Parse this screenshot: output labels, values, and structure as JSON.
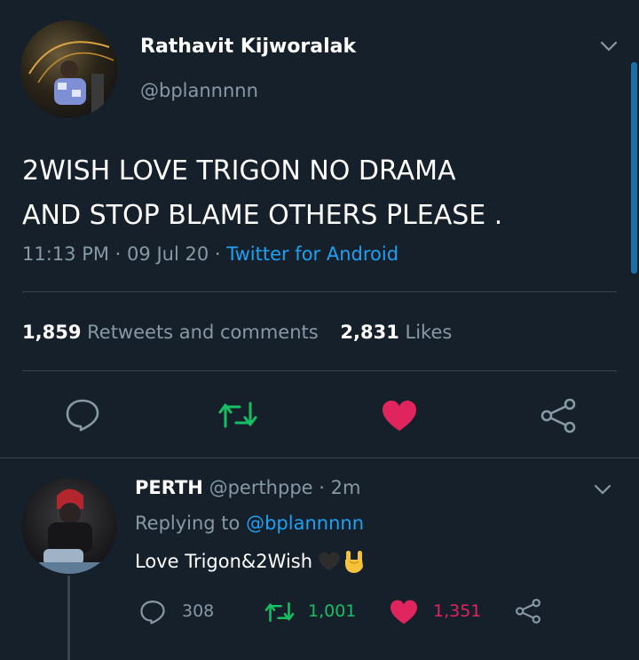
{
  "tweet": {
    "display_name": "Rathavit Kijworalak",
    "handle": "@bplannnnn",
    "text_line1": "2WISH LOVE TRIGON NO DRAMA",
    "text_line2": "AND STOP BLAME OTHERS PLEASE .",
    "time": "11:13 PM",
    "date": "09 Jul 20",
    "client": "Twitter for Android",
    "sep": "·",
    "retweets_count": "1,859",
    "retweets_label": "Retweets and comments",
    "likes_count": "2,831",
    "likes_label": "Likes"
  },
  "reply": {
    "display_name": "PERTH",
    "handle": "@perthppe",
    "sep": "·",
    "age": "2m",
    "replying_prefix": "Replying to",
    "replying_to": "@bplannnnn",
    "text": "Love Trigon&2Wish",
    "reply_count": "308",
    "retweet_count": "1,001",
    "like_count": "1,351"
  },
  "icons": {
    "reply": "reply-icon",
    "retweet": "retweet-icon",
    "like": "heart-icon",
    "share": "share-icon",
    "more": "chevron-down-icon"
  },
  "colors": {
    "background": "#15202b",
    "accent_blue": "#1da1f2",
    "retweet_green": "#17bf63",
    "like_red": "#e0245e",
    "muted": "#8899a6"
  }
}
